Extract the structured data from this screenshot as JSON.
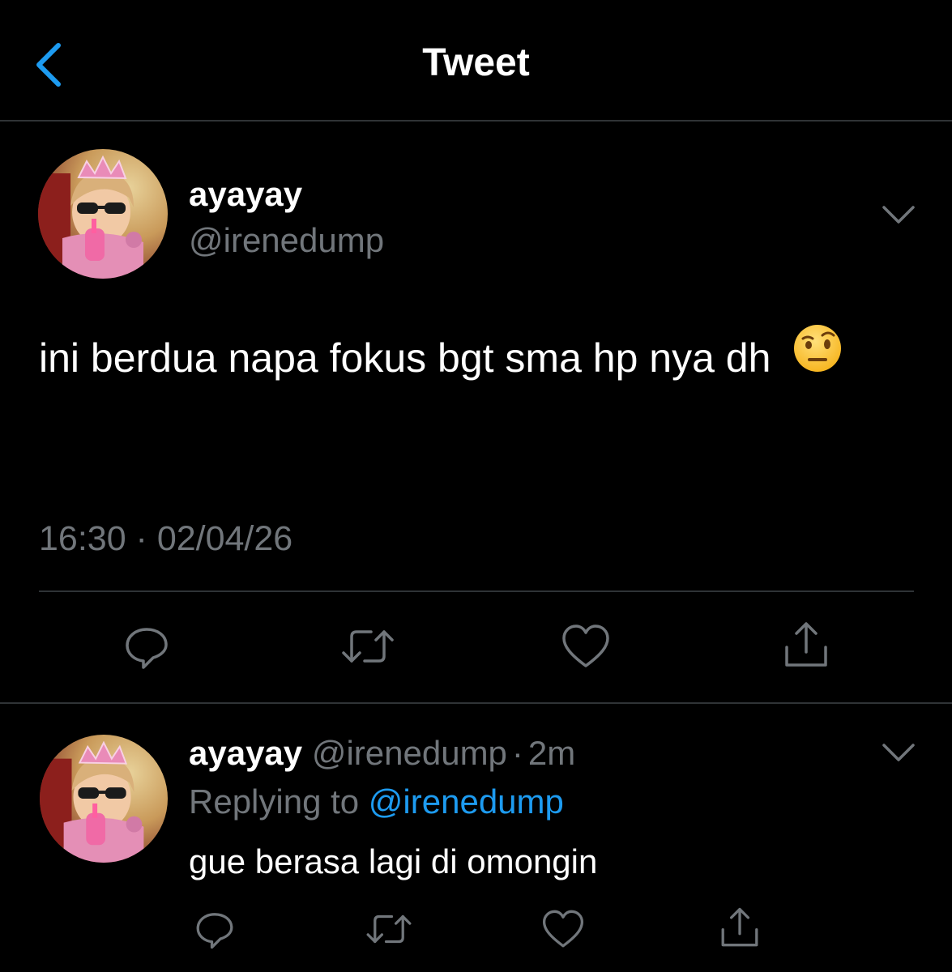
{
  "header": {
    "title": "Tweet",
    "back_icon": "chevron-left-icon",
    "accent_color": "#1d9bf0"
  },
  "main_tweet": {
    "display_name": "ayayay",
    "handle": "@irenedump",
    "text": "ini berdua napa fokus bgt sma hp nya dh",
    "emoji": "face-with-raised-eyebrow",
    "timestamp": "16:30 · 02/04/26",
    "actions": [
      "reply-icon",
      "retweet-icon",
      "like-icon",
      "share-icon"
    ]
  },
  "reply_tweet": {
    "display_name": "ayayay",
    "handle": "@irenedump",
    "separator": "·",
    "time": "2m",
    "replying_prefix": "Replying to",
    "replying_to": "@irenedump",
    "text": "gue berasa lagi di omongin",
    "actions": [
      "reply-icon",
      "retweet-icon",
      "like-icon",
      "share-icon"
    ]
  },
  "colors": {
    "background": "#000000",
    "primary_text": "#ffffff",
    "secondary_text": "#71767b",
    "divider": "#2f3336",
    "link": "#1d9bf0"
  }
}
